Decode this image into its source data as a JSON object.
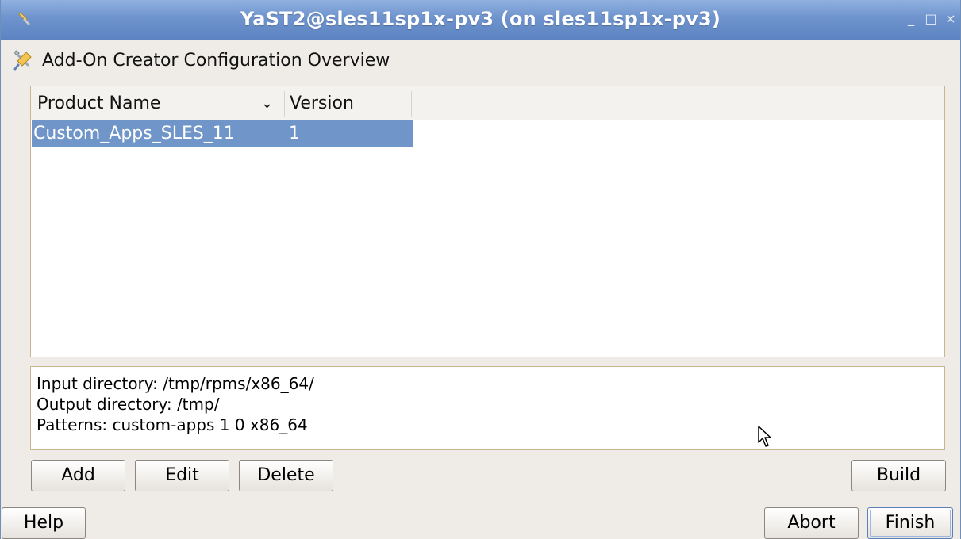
{
  "window": {
    "title": "YaST2@sles11sp1x-pv3 (on sles11sp1x-pv3)",
    "app_icon": "wrench-icon",
    "controls": {
      "minimize": "_",
      "maximize": "□",
      "close": "×"
    }
  },
  "header": {
    "icon": "wrench-screwdriver-icon",
    "title": "Add-On Creator Configuration Overview"
  },
  "table": {
    "columns": [
      "Product Name",
      "Version"
    ],
    "sort_indicator": "chevron-down-icon",
    "rows": [
      {
        "name": "Custom_Apps_SLES_11",
        "version": "1",
        "selected": true
      }
    ]
  },
  "info": {
    "lines": [
      "Input directory: /tmp/rpms/x86_64/",
      "Output directory: /tmp/",
      "Patterns: custom-apps 1 0 x86_64"
    ]
  },
  "buttons": {
    "add": "Add",
    "edit": "Edit",
    "delete": "Delete",
    "build": "Build",
    "help": "Help",
    "abort": "Abort",
    "finish": "Finish"
  },
  "colors": {
    "titlebar": "#6e93cd",
    "selection": "#6f95c9",
    "frame_border": "#c9b58d",
    "background": "#efebe7"
  }
}
